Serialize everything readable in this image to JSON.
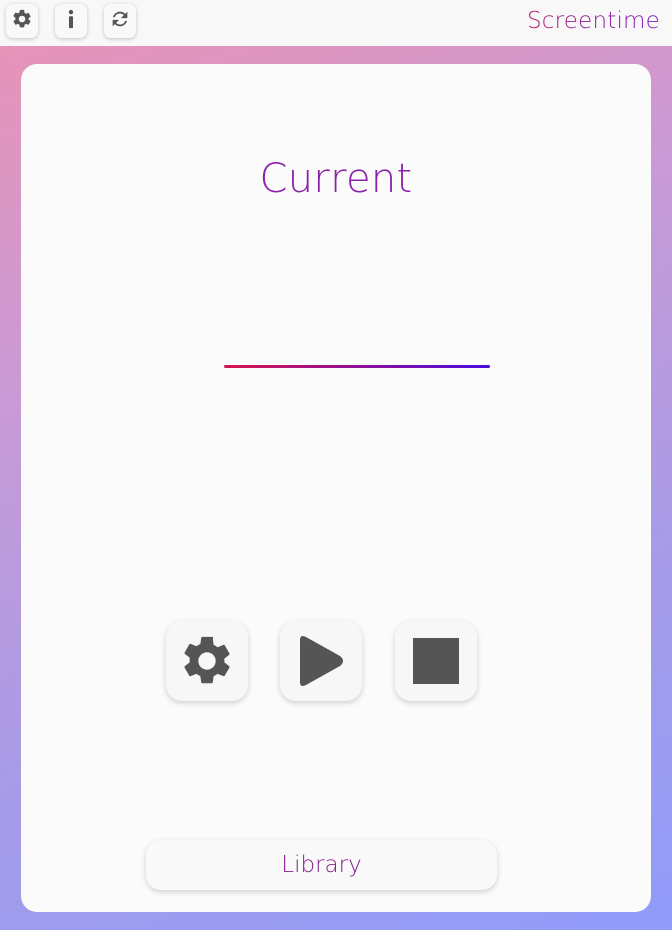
{
  "app": {
    "title": "Screentime"
  },
  "toolbar": {
    "icons": [
      "gear-icon",
      "info-icon",
      "refresh-icon"
    ]
  },
  "card": {
    "heading": "Current",
    "controls": [
      "gear-icon",
      "play-icon",
      "stop-icon"
    ],
    "library_label": "Library"
  },
  "colors": {
    "background_gradient": [
      "#ea93b4",
      "#8f9cfa"
    ],
    "accent_title": "#8a22a8",
    "line_gradient": [
      "#d4164e",
      "#4a0be0"
    ],
    "icon": "#555555"
  }
}
